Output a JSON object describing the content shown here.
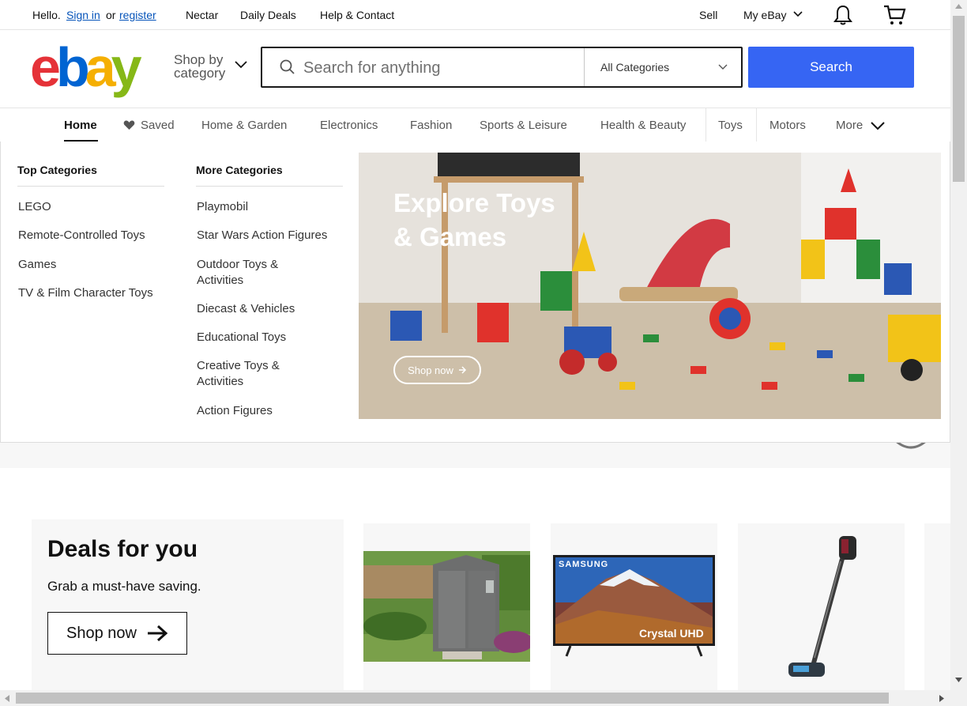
{
  "topbar": {
    "hello": "Hello.",
    "sign_in": "Sign in",
    "or": "or",
    "register": "register",
    "nectar": "Nectar",
    "daily_deals": "Daily Deals",
    "help": "Help & Contact",
    "sell": "Sell",
    "my_ebay": "My eBay"
  },
  "header": {
    "logo_letters": [
      "e",
      "b",
      "a",
      "y"
    ],
    "shop_by_line1": "Shop by",
    "shop_by_line2": "category",
    "search_placeholder": "Search for anything",
    "category_selected": "All Categories",
    "search_button": "Search"
  },
  "nav": {
    "items": [
      "Home",
      "Saved",
      "Home & Garden",
      "Electronics",
      "Fashion",
      "Sports & Leisure",
      "Health & Beauty",
      "Toys",
      "Motors",
      "More"
    ]
  },
  "dropdown": {
    "top_heading": "Top Categories",
    "top_items": [
      "LEGO",
      "Remote-Controlled Toys",
      "Games",
      "TV & Film Character Toys"
    ],
    "more_heading": "More Categories",
    "more_items": [
      "Playmobil",
      "Star Wars Action Figures",
      "Outdoor Toys & Activities",
      "Diecast & Vehicles",
      "Educational Toys",
      "Creative Toys & Activities",
      "Action Figures"
    ],
    "banner_title": "Explore Toys & Games",
    "banner_button": "Shop now"
  },
  "deals": {
    "heading": "Deals for you",
    "subtitle": "Grab a must-have saving.",
    "button": "Shop now"
  },
  "products": {
    "tv_brand": "SAMSUNG",
    "tv_caption": "Crystal UHD"
  },
  "colors": {
    "ebay_red": "#e53238",
    "ebay_blue": "#0064d2",
    "ebay_yellow": "#f5af02",
    "ebay_green": "#86b817",
    "search_blue": "#3665f3",
    "link_blue": "#0654ba"
  }
}
